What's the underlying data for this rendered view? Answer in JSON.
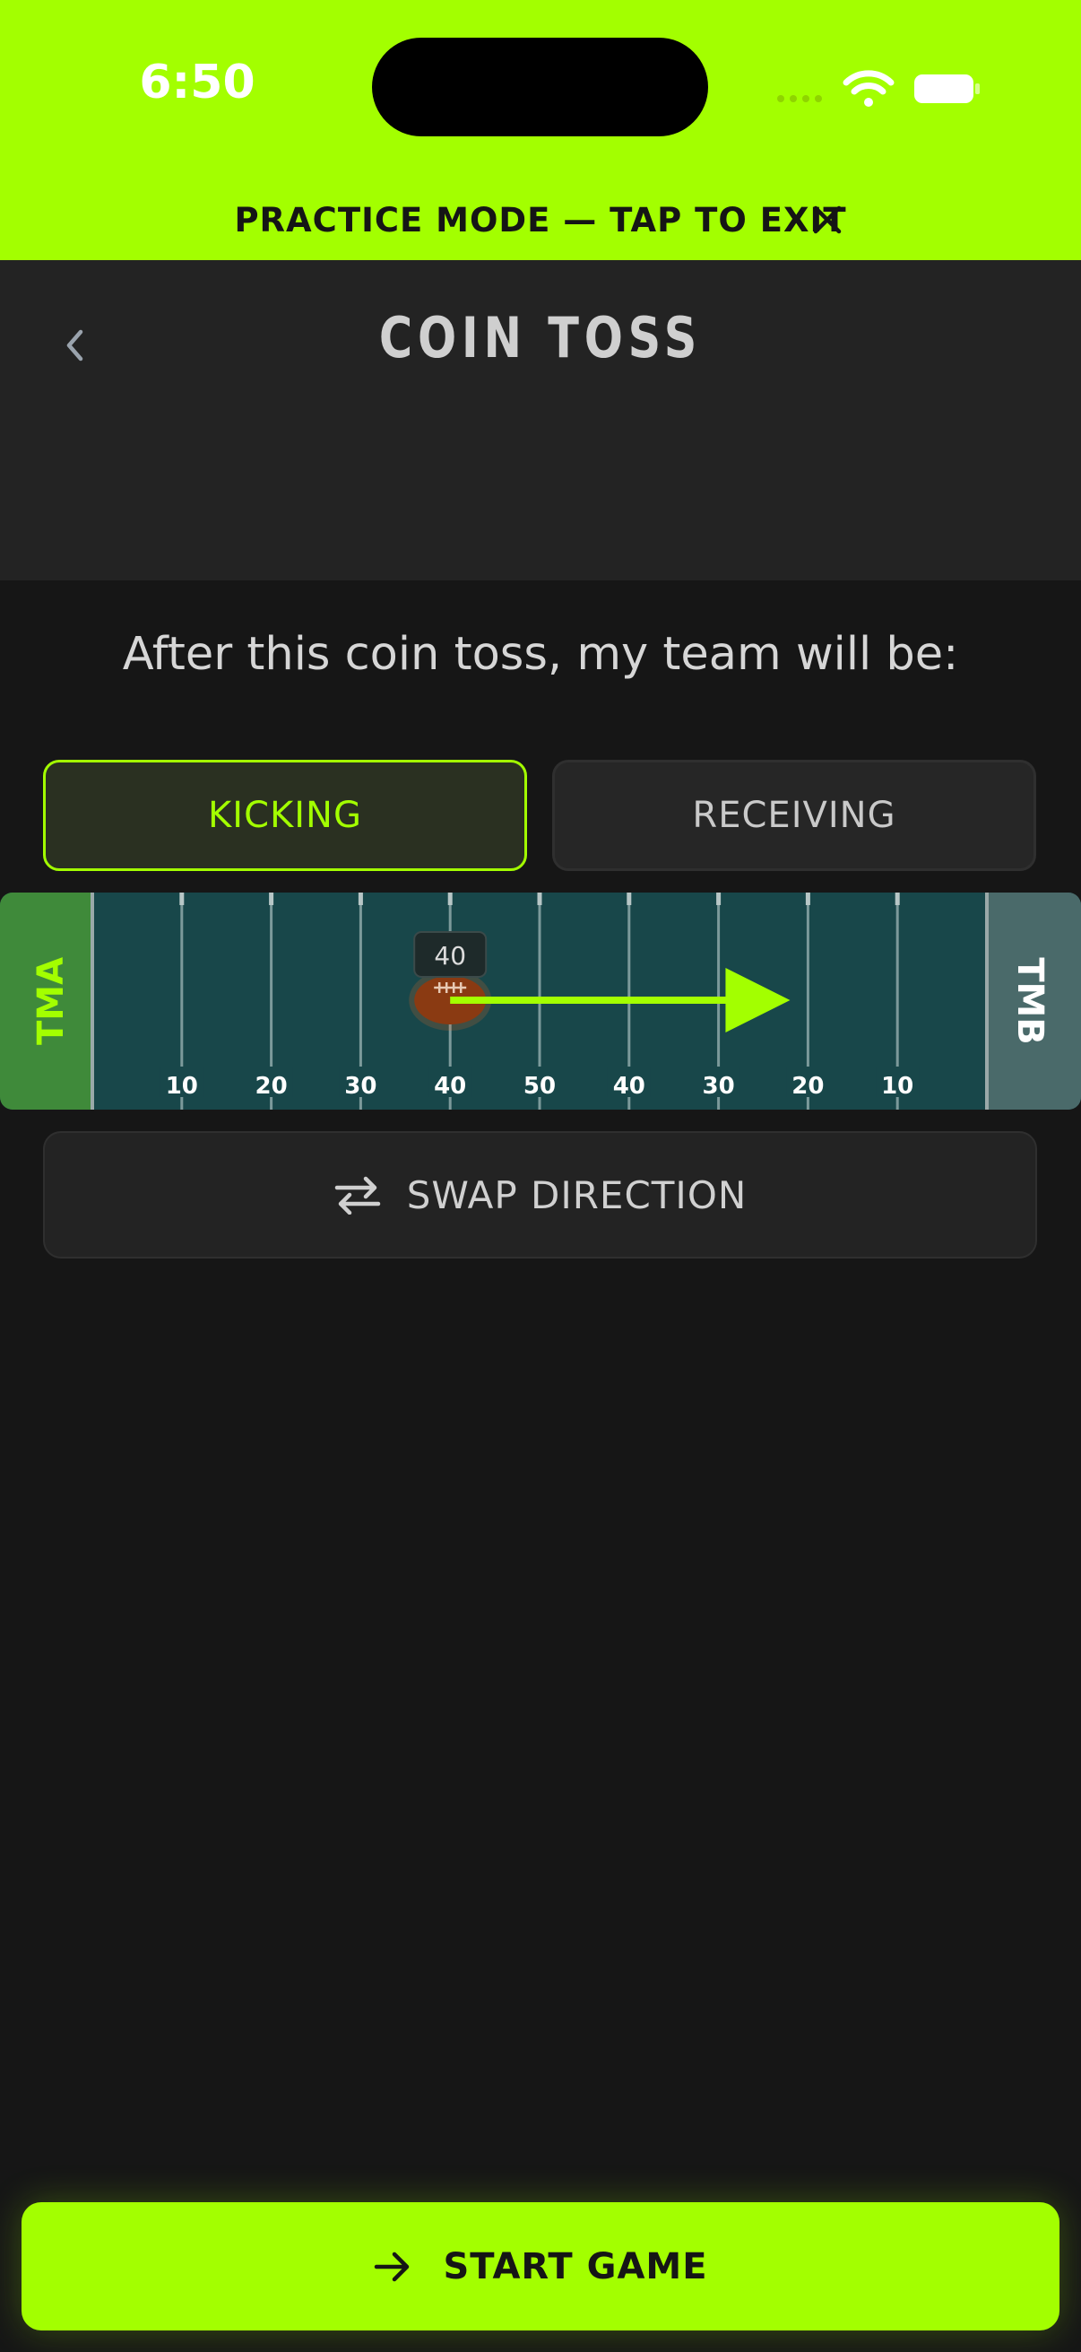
{
  "status_bar": {
    "time": "6:50",
    "battery_level": 1.0
  },
  "practice_banner": {
    "text": "PRACTICE MODE — TAP TO EXIT",
    "close_icon": "close-icon"
  },
  "header": {
    "title": "COIN TOSS",
    "back_icon": "chevron-left-icon"
  },
  "question": "After this coin toss, my team will be:",
  "choices": {
    "kicking": "KICKING",
    "receiving": "RECEIVING",
    "selected": "KICKING"
  },
  "field": {
    "left_team": "TMA",
    "right_team": "TMB",
    "yard_labels": [
      "10",
      "20",
      "30",
      "40",
      "50",
      "40",
      "30",
      "20",
      "10"
    ],
    "ball_yard_line": "40",
    "ball_position_yards": 40,
    "arrow_end_yards": 78,
    "direction": "right",
    "colors": {
      "turf": "#18474a",
      "left_endzone": "#3f8a3a",
      "right_endzone": "#4a6a6a",
      "accent": "#a3ff00",
      "ball": "#8a3a12"
    }
  },
  "swap_button": {
    "label": "SWAP DIRECTION",
    "icon": "swap-arrows-icon"
  },
  "start_button": {
    "label": "START GAME",
    "icon": "arrow-right-icon"
  },
  "colors": {
    "accent": "#a3ff00",
    "background": "#161616",
    "header": "#232323"
  }
}
